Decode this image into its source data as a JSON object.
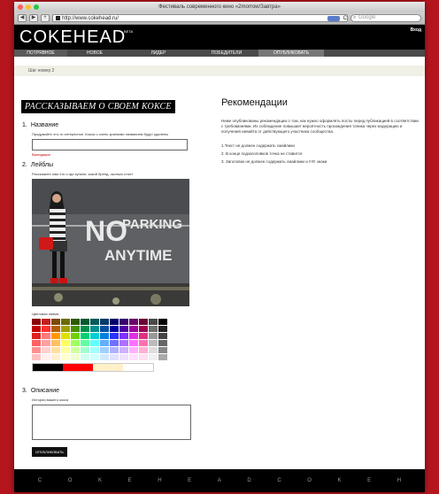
{
  "window": {
    "title": "Фестиваль современного кино «2morrow/Завтра»"
  },
  "browser": {
    "url": "http://www.cokehead.ru/",
    "search_placeholder": "Google",
    "reload": "C"
  },
  "site": {
    "logo": "COKEHEAD",
    "beta": "BETA",
    "login": "Вход"
  },
  "nav": [
    "ПОТРЯВНОЕ",
    "НОВОЕ",
    "ЛИДЕР",
    "ПОБЕДИТЕЛИ",
    "ОПУБЛИКОВАТЬ"
  ],
  "breadcrumb": "Шаг номер 2",
  "form": {
    "heading": "РАССКАЗЫВАЕМ О СВОЕМ КОКСЕ",
    "name_section": {
      "num": "1.",
      "title": "Название",
      "hint": "Придумайте что-то интересное. Коксы с очень краткими названием будут удалены",
      "error": "Валидация"
    },
    "labels_section": {
      "num": "2.",
      "title": "Лейблы",
      "hint": "Расскажите нам что и где купили, какой бренд, сколько стоит"
    },
    "photo": {
      "sign_line1": "NO",
      "sign_line2": "PARKING",
      "sign_line3": "ANYTIME"
    },
    "palette_label": "Цветовая гамма",
    "desc_section": {
      "num": "3.",
      "title": "Описание",
      "hint": "История вашего кокса"
    },
    "submit": "ОПУБЛИКОВАТЬ"
  },
  "palette": [
    "#8b0000",
    "#c41e1e",
    "#7a4a00",
    "#6b6b00",
    "#2e5a00",
    "#005a2e",
    "#005a5a",
    "#003a6b",
    "#00006b",
    "#3a006b",
    "#6b006b",
    "#6b0035",
    "#4a4a4a",
    "#000000",
    "#c00000",
    "#ff3030",
    "#b06000",
    "#a0a000",
    "#4a9000",
    "#00904a",
    "#009090",
    "#0050a0",
    "#0000a0",
    "#5000a0",
    "#a000a0",
    "#a00050",
    "#707070",
    "#222222",
    "#e02020",
    "#ff7b7b",
    "#ff9a00",
    "#e0e000",
    "#70d000",
    "#00d070",
    "#00d0d0",
    "#0080e0",
    "#3030ff",
    "#8030ff",
    "#e030e0",
    "#e03080",
    "#999999",
    "#444444",
    "#ff6060",
    "#ffa0a0",
    "#ffc060",
    "#ffff60",
    "#a0ff60",
    "#60ffa0",
    "#60ffff",
    "#60b0ff",
    "#7070ff",
    "#b070ff",
    "#ff70ff",
    "#ff70b0",
    "#bbbbbb",
    "#666666",
    "#ff9090",
    "#ffd0d0",
    "#ffe0a0",
    "#ffffa0",
    "#d0ffa0",
    "#a0ffd0",
    "#a0ffff",
    "#a0d0ff",
    "#b0b0ff",
    "#d0b0ff",
    "#ffb0ff",
    "#ffb0d0",
    "#dddddd",
    "#888888",
    "#ffc0c0",
    "#fff0f0",
    "#fff0d0",
    "#ffffd0",
    "#f0ffd0",
    "#d0fff0",
    "#d0ffff",
    "#d0e8ff",
    "#e0e0ff",
    "#f0e0ff",
    "#ffe0ff",
    "#ffe0f0",
    "#f0f0f0",
    "#aaaaaa"
  ],
  "selected_colors": [
    "#000000",
    "#ff0000",
    "#fff0c8",
    "#ffffff"
  ],
  "recs": {
    "title": "Рекомендации",
    "text": "Ниже опубликованы рекомендации о том, как нужно оформлять посты перед публикацией в соответствии с требованиями. Их соблюдение повышает вероятность прохождения топика через модерацию и получения инвайта от действующего участника сообщества.",
    "items": [
      "1.Текст не должен содержать смайлики",
      "2. В конце подзаголовков точка не ставится",
      "3. Заголовок не должен содержать смайлики и !!!!!! знаки"
    ]
  },
  "footer_letters": [
    "C",
    "O",
    "K",
    "E",
    "H",
    "E",
    "A",
    "D",
    "C",
    "O",
    "K",
    "E",
    "H"
  ]
}
